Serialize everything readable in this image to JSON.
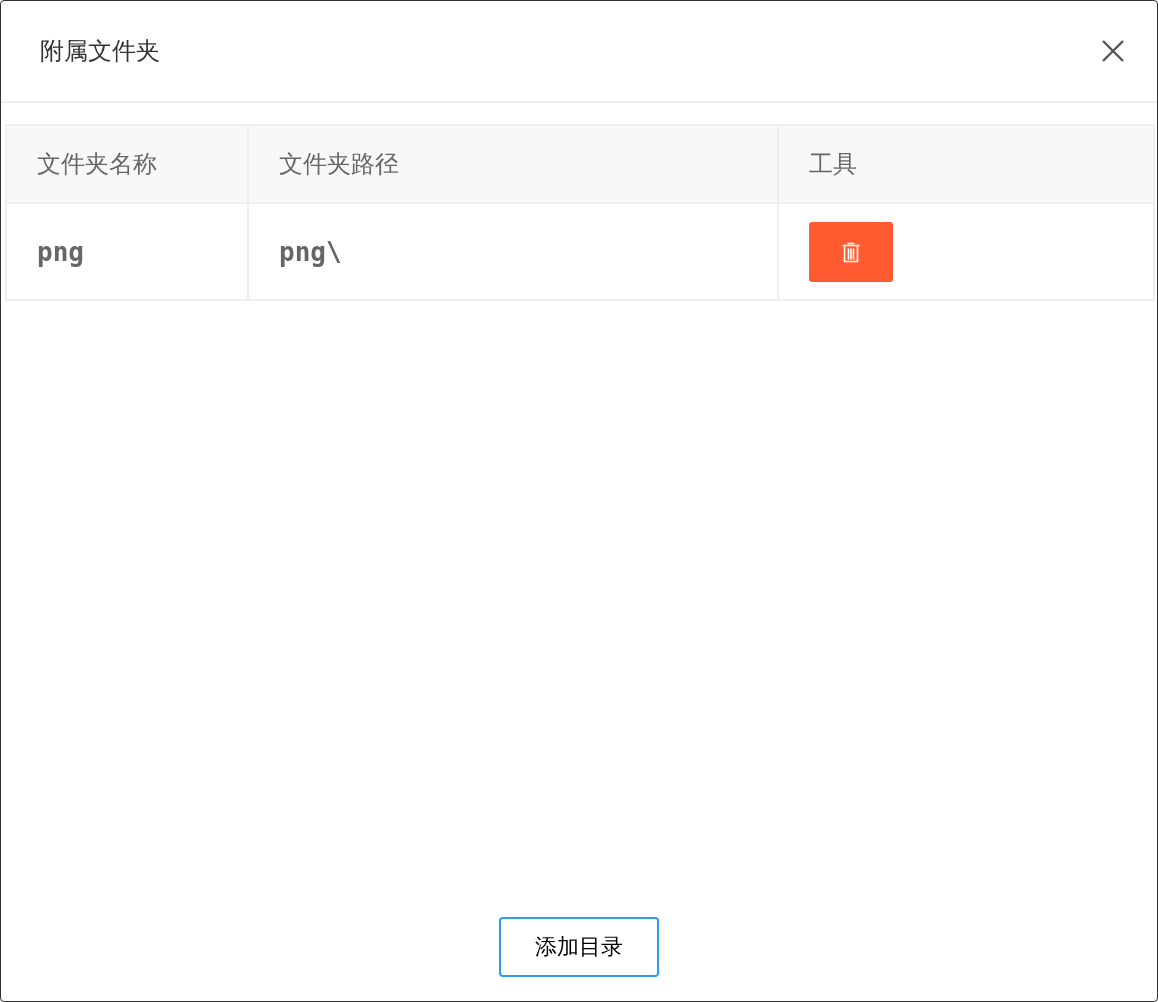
{
  "dialog": {
    "title": "附属文件夹"
  },
  "table": {
    "columns": [
      "文件夹名称",
      "文件夹路径",
      "工具"
    ],
    "rows": [
      {
        "name": "png",
        "path": "png\\"
      }
    ]
  },
  "footer": {
    "button": "添加目录"
  }
}
